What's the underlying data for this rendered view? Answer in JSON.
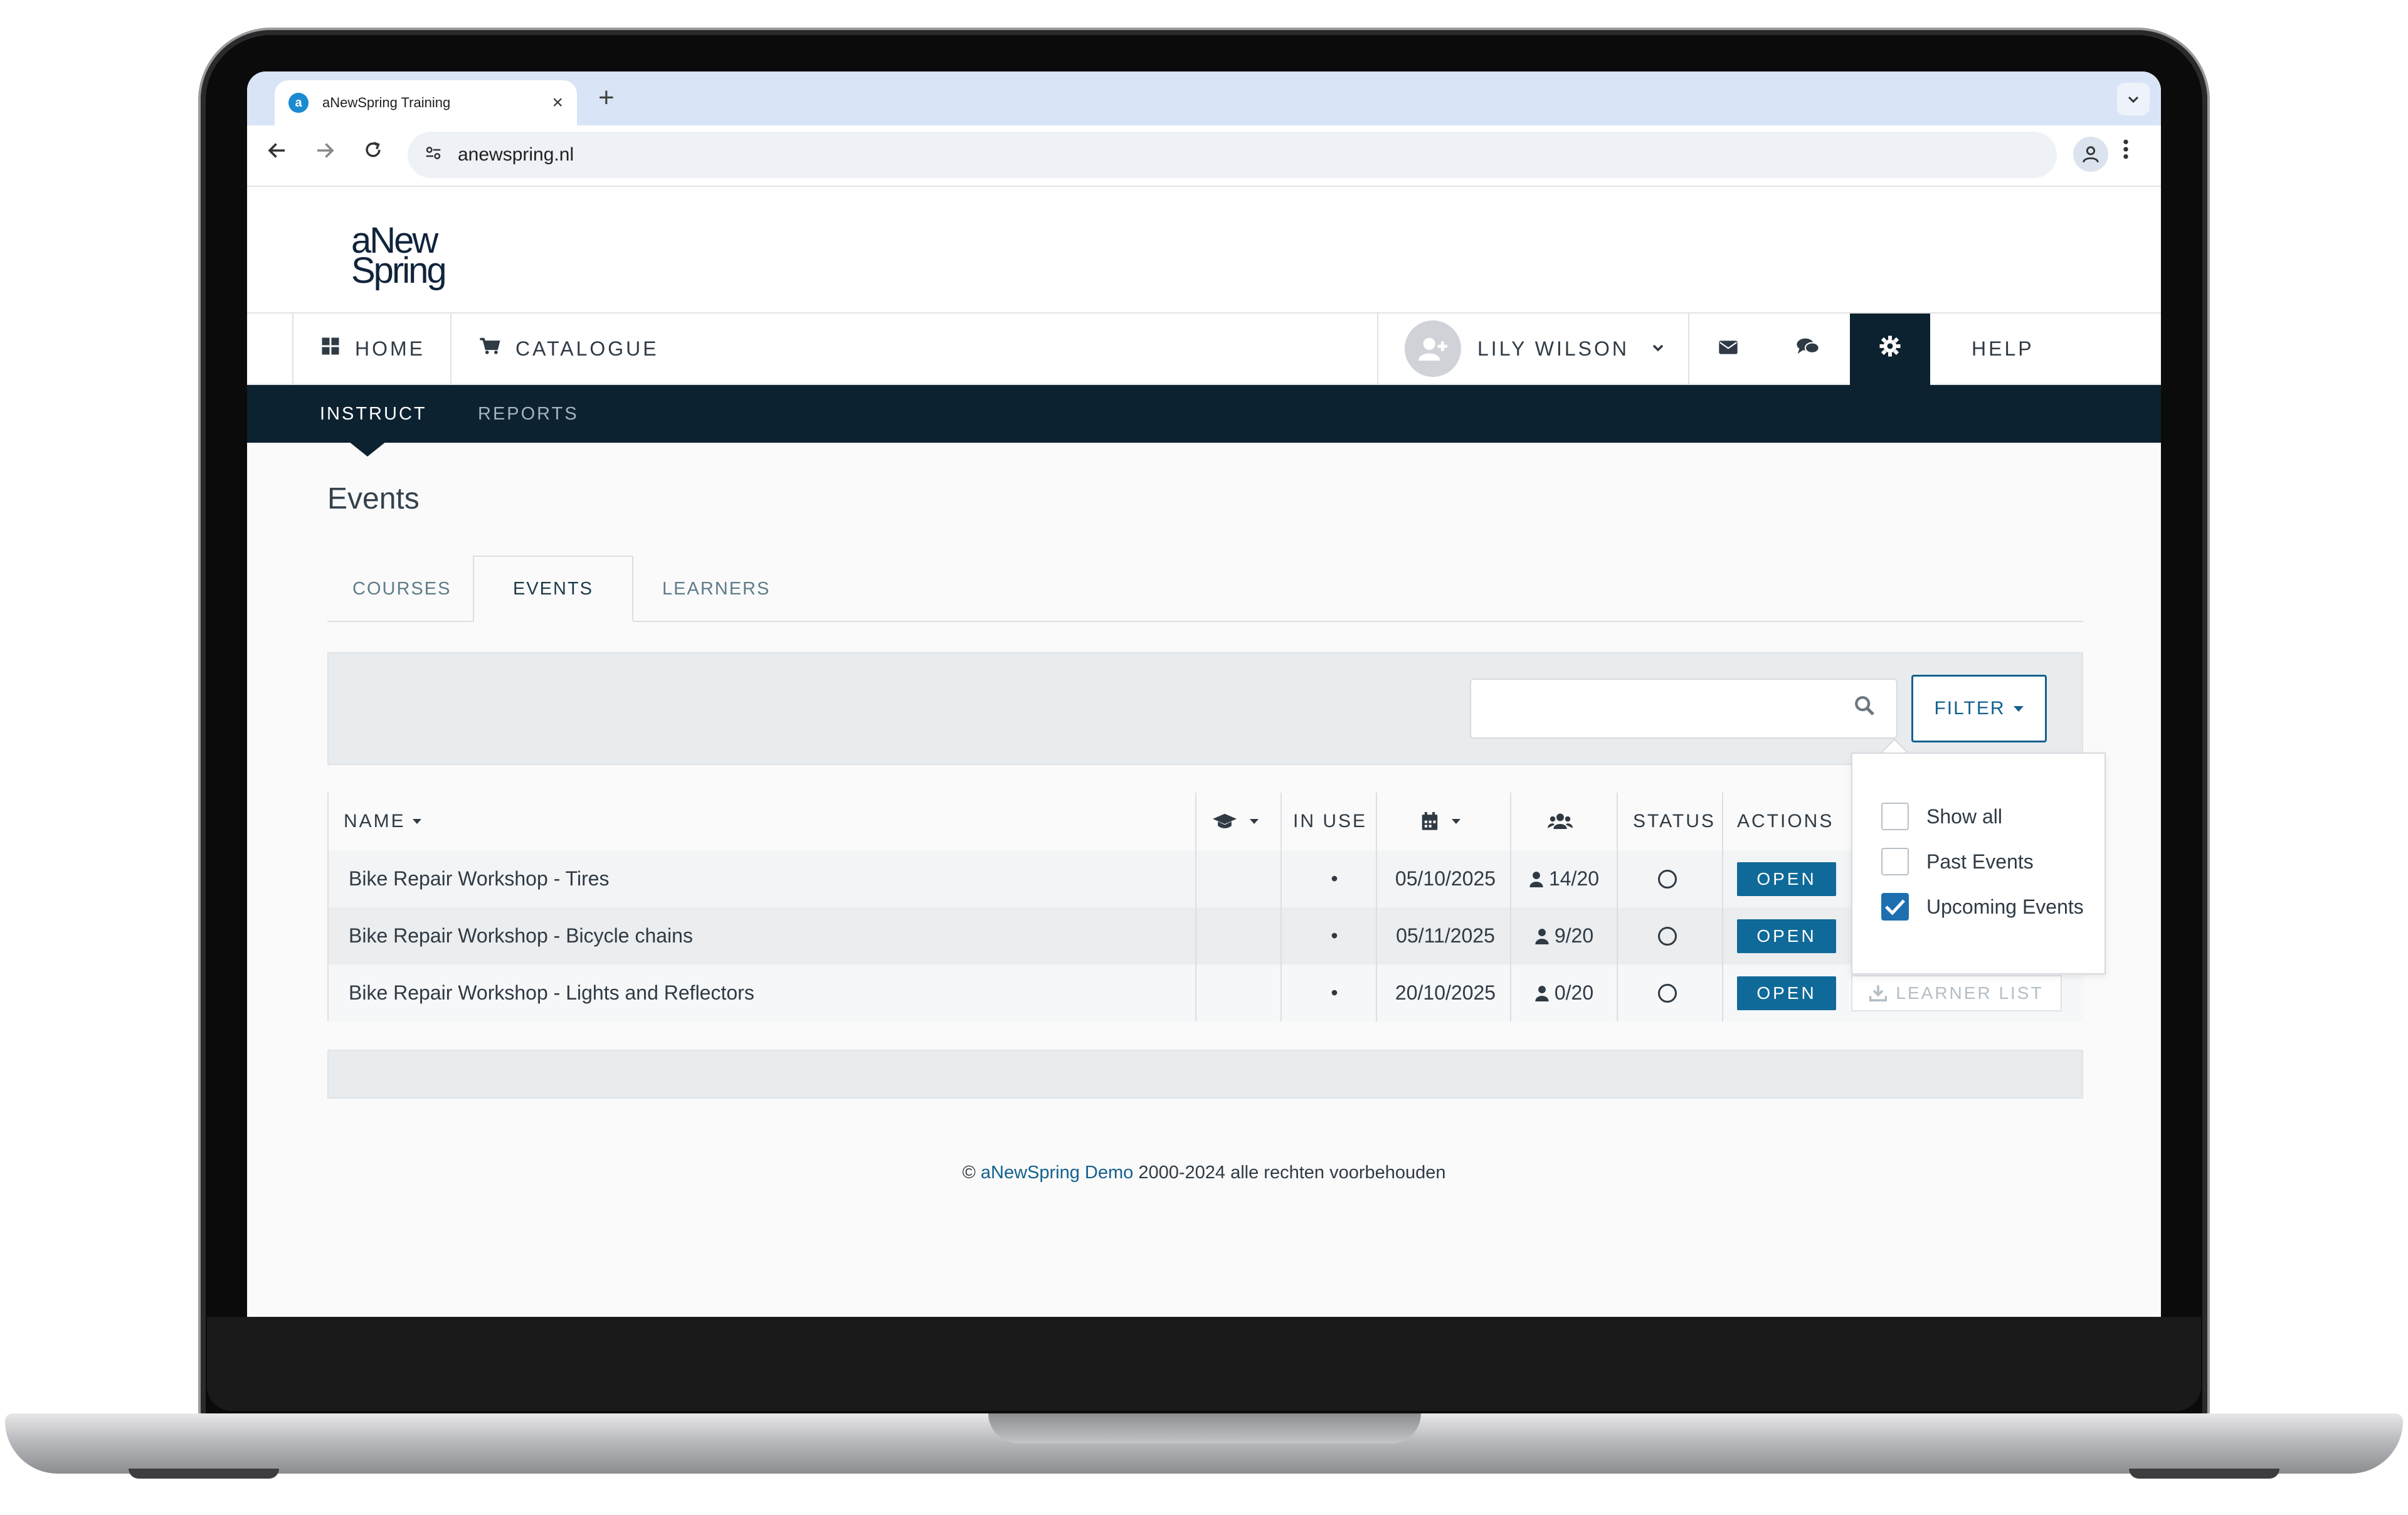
{
  "browser": {
    "tab_title": "aNewSpring Training",
    "tab_favicon": "a",
    "tab_close": "×",
    "new_tab": "+",
    "url": "anewspring.nl"
  },
  "site": {
    "logo_line1": "aNew",
    "logo_line2": "Spring"
  },
  "main_nav": {
    "home": "HOME",
    "catalogue": "CATALOGUE",
    "user": "LILY WILSON",
    "help": "HELP"
  },
  "sub_nav": {
    "instruct": "INSTRUCT",
    "reports": "REPORTS"
  },
  "page": {
    "title": "Events",
    "tabs": [
      "COURSES",
      "EVENTS",
      "LEARNERS"
    ],
    "active_tab": "EVENTS"
  },
  "search": {
    "placeholder": ""
  },
  "filter": {
    "label": "FILTER",
    "options": [
      {
        "label": "Show all",
        "checked": false
      },
      {
        "label": "Past Events",
        "checked": false
      },
      {
        "label": "Upcoming Events",
        "checked": true
      }
    ]
  },
  "table": {
    "headers": {
      "name": "NAME",
      "in_use": "IN USE",
      "status": "STATUS",
      "actions": "ACTIONS"
    },
    "rows": [
      {
        "name": "Bike Repair Workshop - Tires",
        "in_use": "•",
        "date": "05/10/2025",
        "participants": "14/20",
        "open": "OPEN"
      },
      {
        "name": "Bike Repair Workshop - Bicycle chains",
        "in_use": "•",
        "date": "05/11/2025",
        "participants": "9/20",
        "open": "OPEN"
      },
      {
        "name": "Bike Repair Workshop - Lights and Reflectors",
        "in_use": "•",
        "date": "20/10/2025",
        "participants": "0/20",
        "open": "OPEN",
        "learner_list": "LEARNER LIST"
      }
    ]
  },
  "footer": {
    "prefix": "©",
    "link": "aNewSpring Demo",
    "suffix": "2000-2024 alle rechten voorbehouden"
  },
  "colors": {
    "dark_nav": "#0c2230",
    "accent": "#0f6a99",
    "checkbox": "#1d6fb0"
  }
}
